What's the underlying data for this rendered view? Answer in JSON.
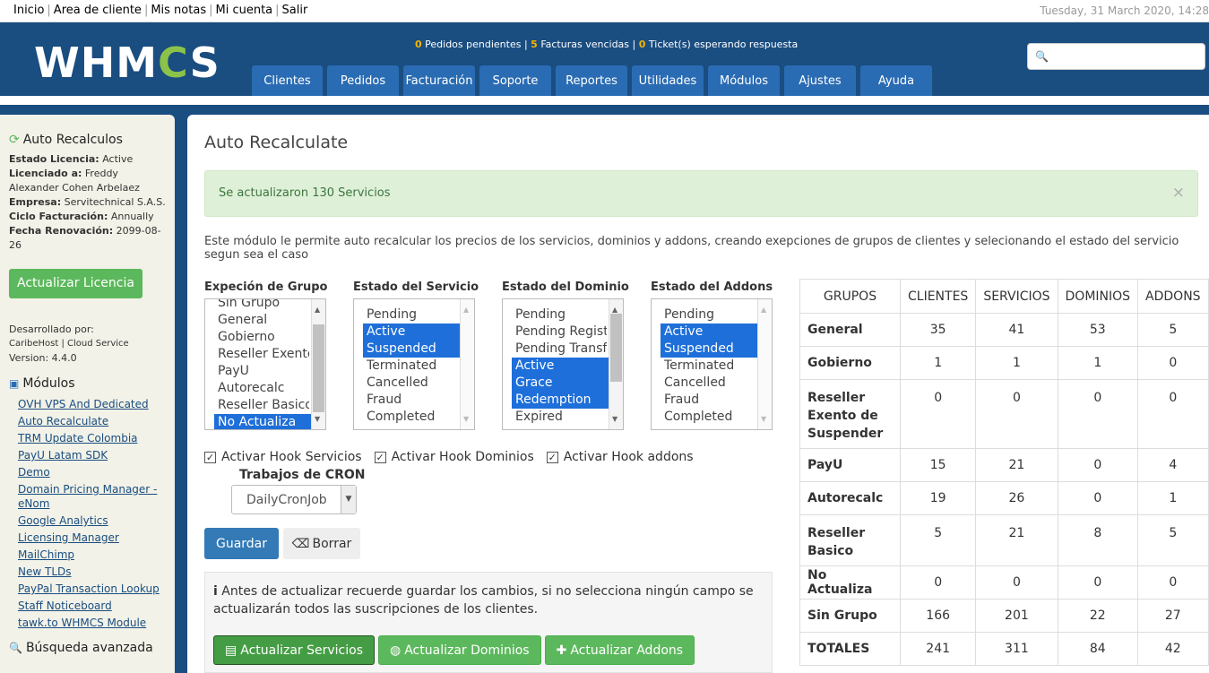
{
  "topbar": {
    "links": [
      "Inicio",
      "Area de cliente",
      "Mis notas",
      "Mi cuenta",
      "Salir"
    ],
    "date": "Tuesday, 31 March 2020, 14:28"
  },
  "header": {
    "logo_a": "WHM",
    "logo_b": "C",
    "logo_c": "S",
    "stats": {
      "pedidos_n": "0",
      "pedidos": "Pedidos pendientes",
      "facturas_n": "5",
      "facturas": "Facturas vencidas",
      "tickets_n": "0",
      "tickets": "Ticket(s) esperando respuesta"
    },
    "nav": [
      "Clientes",
      "Pedidos",
      "Facturación",
      "Soporte",
      "Reportes",
      "Utilidades",
      "Módulos",
      "Ajustes",
      "Ayuda"
    ],
    "search_icon": "🔍"
  },
  "sidebar": {
    "title": "Auto Recalculos",
    "license": [
      {
        "k": "Estado Licencia:",
        "v": "Active"
      },
      {
        "k": "Licenciado a:",
        "v": "Freddy Alexander Cohen Arbelaez"
      },
      {
        "k": "Empresa:",
        "v": "Servitechnical S.A.S."
      },
      {
        "k": "Ciclo Facturación:",
        "v": "Annually"
      },
      {
        "k": "Fecha Renovación:",
        "v": "2099-08-26"
      }
    ],
    "update_button": "Actualizar Licencia",
    "dev_label": "Desarrollado por:",
    "dev_name": "CaribeHost | Cloud Service",
    "version": "Version: 4.4.0",
    "modules_title": "Módulos",
    "modules": [
      "OVH VPS And Dedicated",
      "Auto Recalculate",
      "TRM Update Colombia",
      "PayU Latam SDK",
      "Demo",
      "Domain Pricing Manager - eNom",
      "Google Analytics",
      "Licensing Manager",
      "MailChimp",
      "New TLDs",
      "PayPal Transaction Lookup",
      "Staff Noticeboard",
      "tawk.to WHMCS Module"
    ],
    "advanced": "Búsqueda avanzada"
  },
  "main": {
    "title": "Auto Recalculate",
    "alert": "Se actualizaron 130 Servicios",
    "close": "×",
    "description": "Este módulo le permite auto recalcular los precios de los servicios, dominios y addons, creando exepciones de grupos de clientes y selecionando el estado del servicio segun sea el caso",
    "lists": [
      {
        "title": "Expeción de Grupo",
        "options": [
          {
            "t": "Sin Grupo",
            "s": false
          },
          {
            "t": "General",
            "s": false
          },
          {
            "t": "Gobierno",
            "s": false
          },
          {
            "t": "Reseller Exento",
            "s": false
          },
          {
            "t": "PayU",
            "s": false
          },
          {
            "t": "Autorecalc",
            "s": false
          },
          {
            "t": "Reseller Basico",
            "s": false
          },
          {
            "t": "No Actualiza",
            "s": true
          }
        ]
      },
      {
        "title": "Estado del Servicio",
        "options": [
          {
            "t": "Pending",
            "s": false
          },
          {
            "t": "Active",
            "s": true
          },
          {
            "t": "Suspended",
            "s": true
          },
          {
            "t": "Terminated",
            "s": false
          },
          {
            "t": "Cancelled",
            "s": false
          },
          {
            "t": "Fraud",
            "s": false
          },
          {
            "t": "Completed",
            "s": false
          }
        ]
      },
      {
        "title": "Estado del Dominio",
        "options": [
          {
            "t": "Pending",
            "s": false
          },
          {
            "t": "Pending Registr",
            "s": false
          },
          {
            "t": "Pending Transfe",
            "s": false
          },
          {
            "t": "Active",
            "s": true
          },
          {
            "t": "Grace",
            "s": true
          },
          {
            "t": "Redemption",
            "s": true
          },
          {
            "t": "Expired",
            "s": false
          }
        ]
      },
      {
        "title": "Estado del Addons",
        "options": [
          {
            "t": "Pending",
            "s": false
          },
          {
            "t": "Active",
            "s": true
          },
          {
            "t": "Suspended",
            "s": true
          },
          {
            "t": "Terminated",
            "s": false
          },
          {
            "t": "Cancelled",
            "s": false
          },
          {
            "t": "Fraud",
            "s": false
          },
          {
            "t": "Completed",
            "s": false
          }
        ]
      }
    ],
    "checks": [
      "Activar Hook Servicios",
      "Activar Hook Dominios",
      "Activar Hook addons"
    ],
    "check_mark": "✓",
    "cron_label": "Trabajos de CRON",
    "cron_value": "DailyCronJob",
    "save": "Guardar",
    "clear": "Borrar",
    "info": "Antes de actualizar recuerde guardar los cambios, si no selecciona ningún campo se actualizarán todos las suscripciones de los clientes.",
    "update_services": "Actualizar Servicios",
    "update_domains": "Actualizar Dominios",
    "update_addons": "Actualizar Addons"
  },
  "table": {
    "headers": [
      "GRUPOS",
      "CLIENTES",
      "SERVICIOS",
      "DOMINIOS",
      "ADDONS"
    ],
    "rows": [
      [
        "General",
        "35",
        "41",
        "53",
        "5"
      ],
      [
        "Gobierno",
        "1",
        "1",
        "1",
        "0"
      ],
      [
        "Reseller Exento de Suspender",
        "0",
        "0",
        "0",
        "0"
      ],
      [
        "PayU",
        "15",
        "21",
        "0",
        "4"
      ],
      [
        "Autorecalc",
        "19",
        "26",
        "0",
        "1"
      ],
      [
        "Reseller Basico",
        "5",
        "21",
        "8",
        "5"
      ],
      [
        "No Actualiza",
        "0",
        "0",
        "0",
        "0"
      ],
      [
        "Sin Grupo",
        "166",
        "201",
        "22",
        "27"
      ],
      [
        "TOTALES",
        "241",
        "311",
        "84",
        "42"
      ]
    ]
  }
}
